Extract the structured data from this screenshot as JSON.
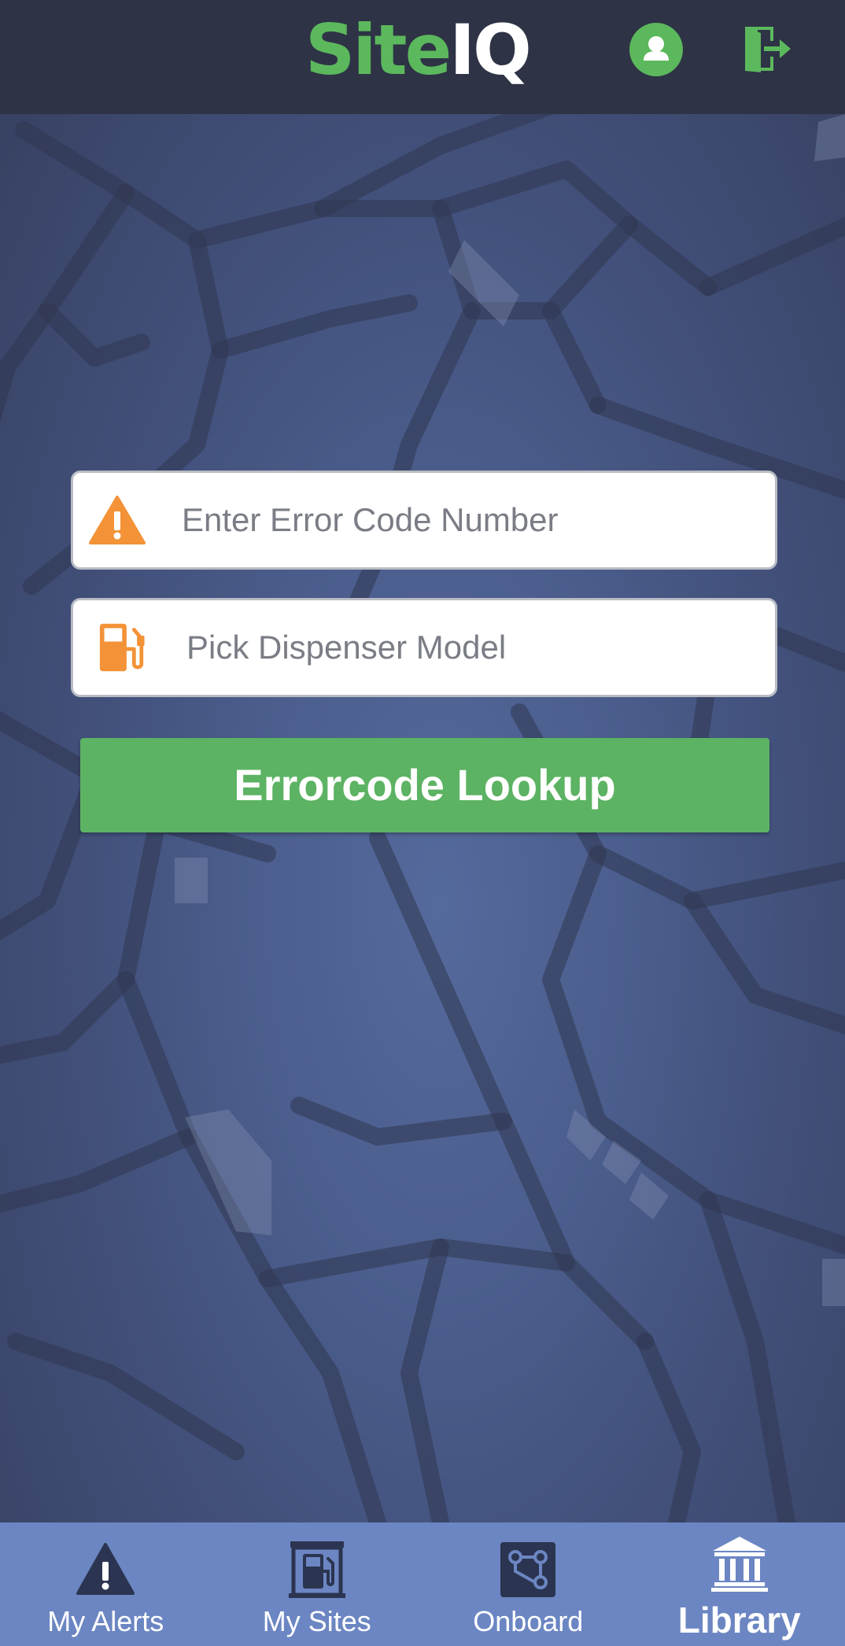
{
  "header": {
    "logo_part1": "Site",
    "logo_part2": "IQ",
    "profile_icon": "user-icon",
    "logout_icon": "logout-icon"
  },
  "form": {
    "error_code": {
      "icon": "warning-icon",
      "placeholder": "Enter Error Code Number",
      "value": ""
    },
    "dispenser": {
      "icon": "fuel-pump-icon",
      "placeholder": "Pick Dispenser Model"
    },
    "lookup_button_label": "Errorcode Lookup"
  },
  "nav": {
    "items": [
      {
        "label": "My Alerts",
        "icon": "alert-icon",
        "active": false
      },
      {
        "label": "My Sites",
        "icon": "gas-station-icon",
        "active": false
      },
      {
        "label": "Onboard",
        "icon": "onboard-icon",
        "active": false
      },
      {
        "label": "Library",
        "icon": "library-icon",
        "active": true
      }
    ]
  },
  "colors": {
    "brand_green": "#5cb85c",
    "header_bg": "#2e3346",
    "nav_bg": "#6b86c2",
    "accent_orange": "#f39237"
  }
}
